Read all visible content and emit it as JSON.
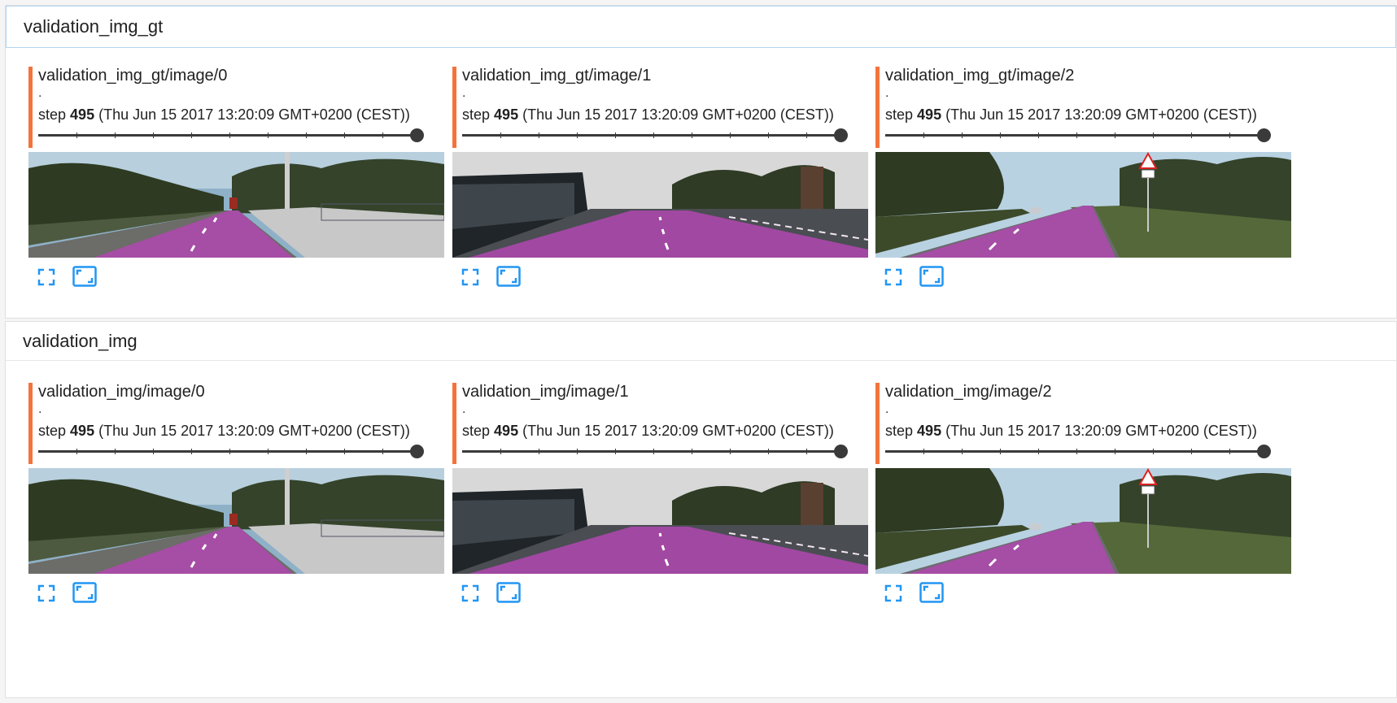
{
  "sections": [
    {
      "header": "validation_img_gt",
      "cards": [
        {
          "title": "validation_img_gt/image/0",
          "dot": ".",
          "step_prefix": "step",
          "step": "495",
          "step_suffix": "(Thu Jun 15 2017 13:20:09 GMT+0200 (CEST))"
        },
        {
          "title": "validation_img_gt/image/1",
          "dot": ".",
          "step_prefix": "step",
          "step": "495",
          "step_suffix": "(Thu Jun 15 2017 13:20:09 GMT+0200 (CEST))"
        },
        {
          "title": "validation_img_gt/image/2",
          "dot": ".",
          "step_prefix": "step",
          "step": "495",
          "step_suffix": "(Thu Jun 15 2017 13:20:09 GMT+0200 (CEST))"
        }
      ]
    },
    {
      "header": "validation_img",
      "cards": [
        {
          "title": "validation_img/image/0",
          "dot": ".",
          "step_prefix": "step",
          "step": "495",
          "step_suffix": "(Thu Jun 15 2017 13:20:09 GMT+0200 (CEST))"
        },
        {
          "title": "validation_img/image/1",
          "dot": ".",
          "step_prefix": "step",
          "step": "495",
          "step_suffix": "(Thu Jun 15 2017 13:20:09 GMT+0200 (CEST))"
        },
        {
          "title": "validation_img/image/2",
          "dot": ".",
          "step_prefix": "step",
          "step": "495",
          "step_suffix": "(Thu Jun 15 2017 13:20:09 GMT+0200 (CEST))"
        }
      ]
    }
  ],
  "slider_value_fraction": 1.0,
  "icons": {
    "expand": "fullscreen-icon",
    "fit": "fit-to-screen-icon"
  },
  "colors": {
    "accent_bar": "#f4733b",
    "icon_blue": "#2196f3",
    "road_overlay": "#b048b0"
  }
}
